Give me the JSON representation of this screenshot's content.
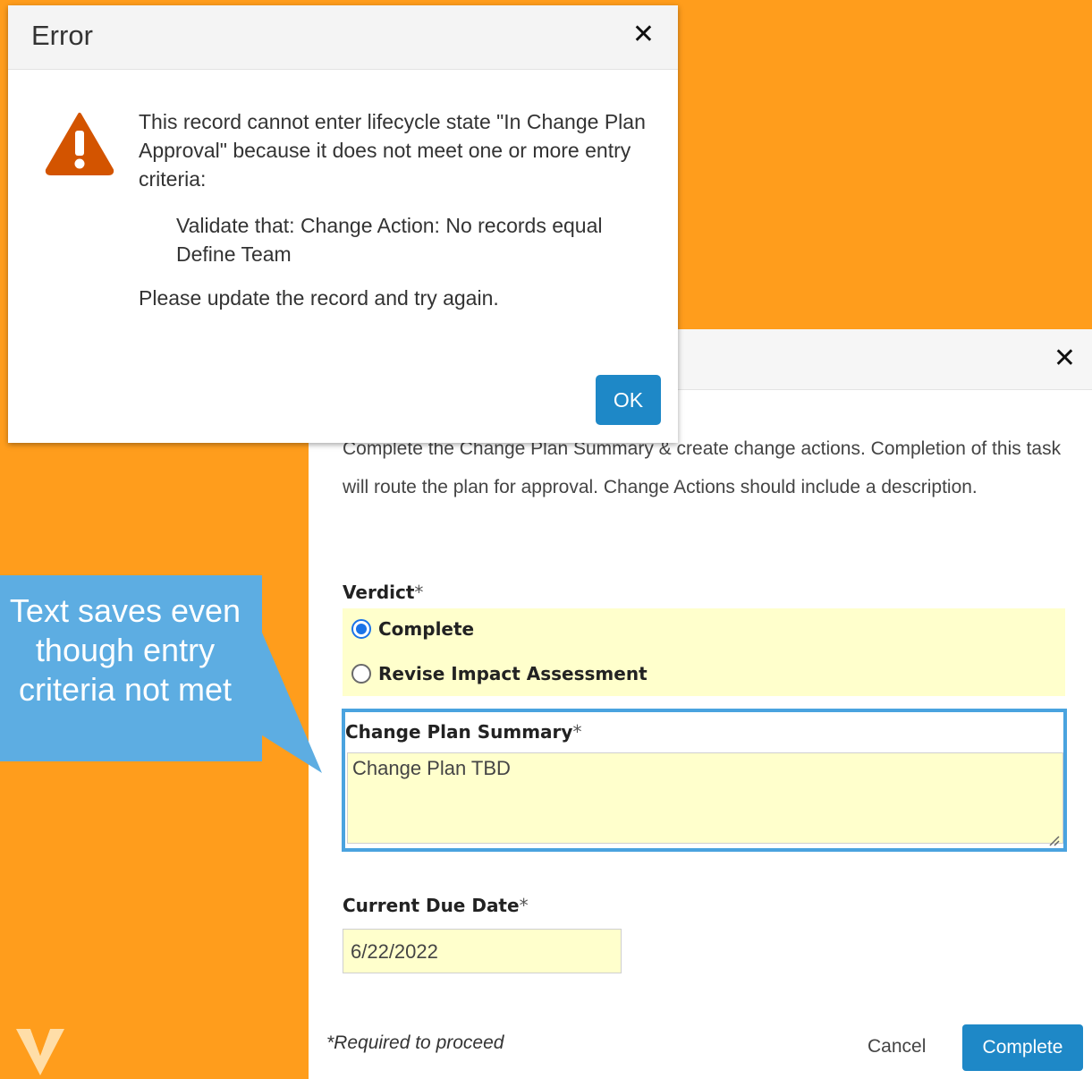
{
  "error_dialog": {
    "title": "Error",
    "message": "This record cannot enter lifecycle state \"In Change Plan Approval\" because it does not meet one or more entry criteria:",
    "criteria": "Validate that: Change Action: No records equal Define Team",
    "hint": "Please update the record and try again.",
    "ok_label": "OK",
    "icon": "warning-icon",
    "close_icon": "close-icon"
  },
  "task_dialog": {
    "close_icon": "close-icon",
    "instructions": "Complete the Change Plan Summary & create change actions. Completion of this task will route the plan for approval. Change Actions should include a description.",
    "verdict": {
      "label": "Verdict",
      "required_mark": "*",
      "options": [
        {
          "label": "Complete",
          "selected": true
        },
        {
          "label": "Revise Impact Assessment",
          "selected": false
        }
      ]
    },
    "summary": {
      "label": "Change Plan Summary",
      "required_mark": "*",
      "value": "Change Plan TBD"
    },
    "due_date": {
      "label": "Current Due Date",
      "required_mark": "*",
      "value": "6/22/2022"
    },
    "required_note": "*Required to proceed",
    "cancel_label": "Cancel",
    "complete_label": "Complete"
  },
  "callout": {
    "text": "Text saves even though entry criteria not met"
  },
  "colors": {
    "background": "#FF9D1C",
    "callout": "#5DADE2",
    "primary_button": "#1E88C7",
    "field_highlight": "#FFFFCC",
    "focus_border": "#4AA3DF",
    "warning": "#D35400"
  },
  "logo": "veeva-logo"
}
